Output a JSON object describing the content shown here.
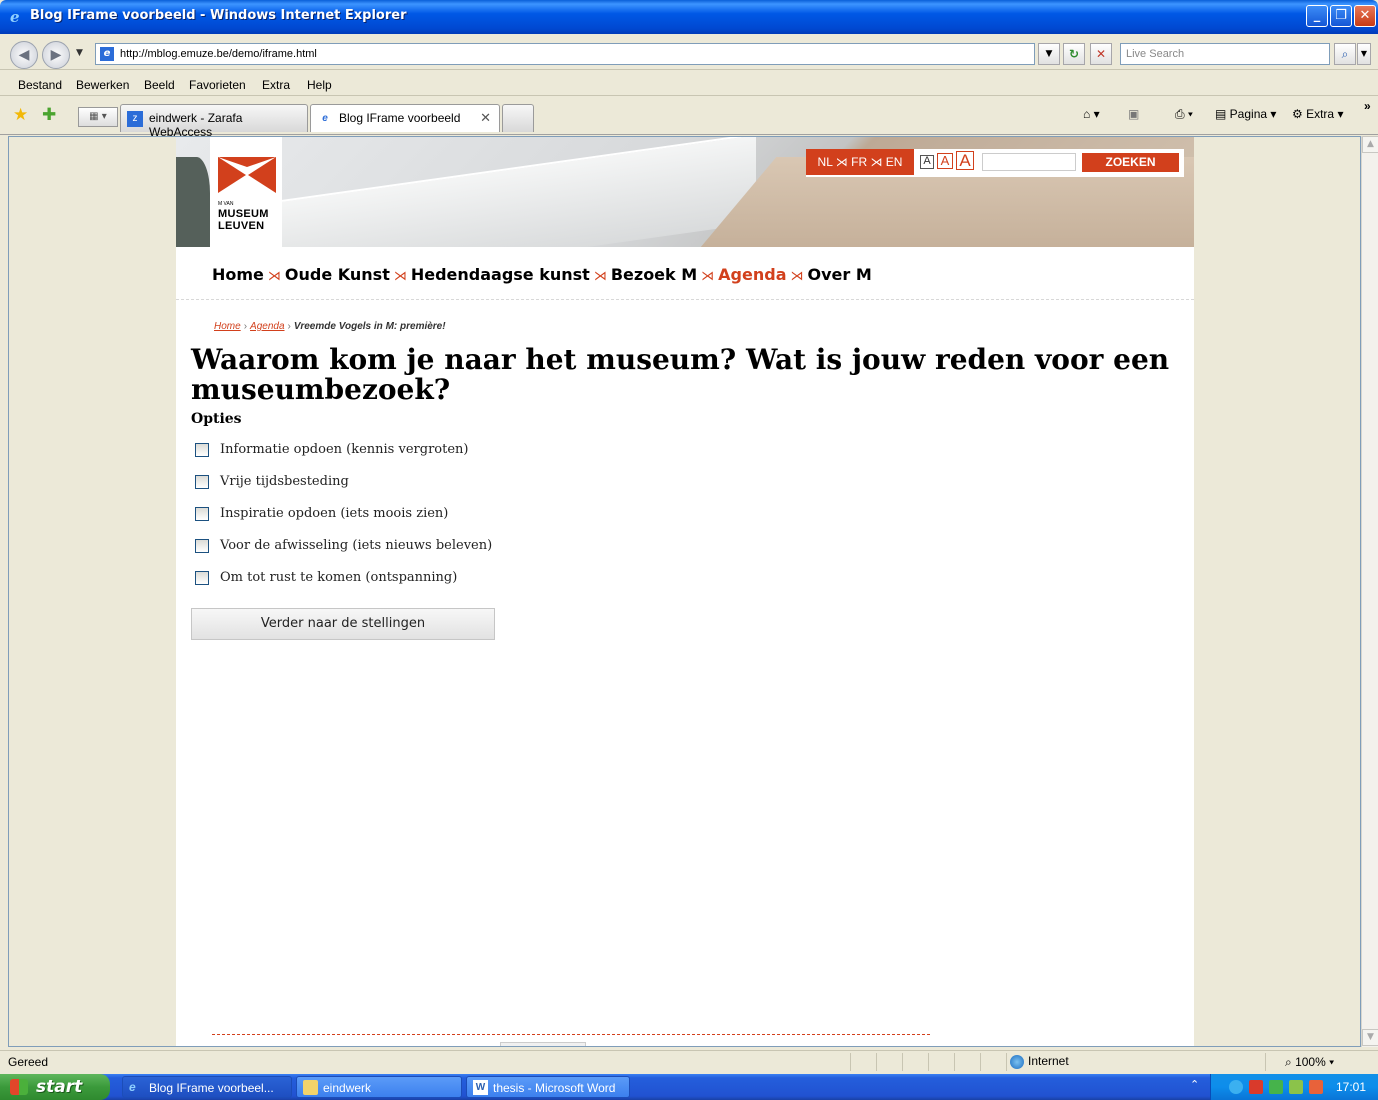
{
  "window": {
    "title": "Blog IFrame voorbeeld - Windows Internet Explorer"
  },
  "address": {
    "url": "http://mblog.emuze.be/demo/iframe.html",
    "search_placeholder": "Live Search"
  },
  "menu": {
    "items": [
      "Bestand",
      "Bewerken",
      "Beeld",
      "Favorieten",
      "Extra",
      "Help"
    ]
  },
  "tabs": [
    {
      "label": "eindwerk - Zarafa WebAccess"
    },
    {
      "label": "Blog IFrame voorbeeld"
    }
  ],
  "command_bar": {
    "page_label": "Pagina",
    "extra_label": "Extra"
  },
  "site": {
    "logo_small": "M VAN",
    "logo_line1": "MUSEUM",
    "logo_line2": "LEUVEN",
    "languages": "NL ⋊ FR ⋊ EN",
    "font_sizes": [
      "A",
      "A",
      "A"
    ],
    "search_button": "ZOEKEN",
    "nav": {
      "home": "Home",
      "oude": "Oude Kunst",
      "hedendaags": "Hedendaagse kunst",
      "bezoek": "Bezoek M",
      "agenda": "Agenda",
      "over": "Over M"
    },
    "breadcrumb": {
      "home": "Home",
      "agenda": "Agenda",
      "current": "Vreemde Vogels in M: première!"
    }
  },
  "poll": {
    "question": "Waarom kom je naar het museum? Wat is jouw reden voor een museumbezoek?",
    "options_heading": "Opties",
    "options": [
      "Informatie opdoen (kennis vergroten)",
      "Vrije tijdsbesteding",
      "Inspiratie opdoen (iets moois zien)",
      "Voor de afwisseling (iets nieuws beleven)",
      "Om tot rust te komen (ontspanning)"
    ],
    "submit_label": "Verder naar de stellingen"
  },
  "status": {
    "text": "Gereed",
    "zone": "Internet",
    "zoom": "100%"
  },
  "taskbar": {
    "start": "start",
    "items": [
      "Blog IFrame voorbeel...",
      "eindwerk",
      "thesis - Microsoft Word"
    ],
    "clock": "17:01"
  }
}
